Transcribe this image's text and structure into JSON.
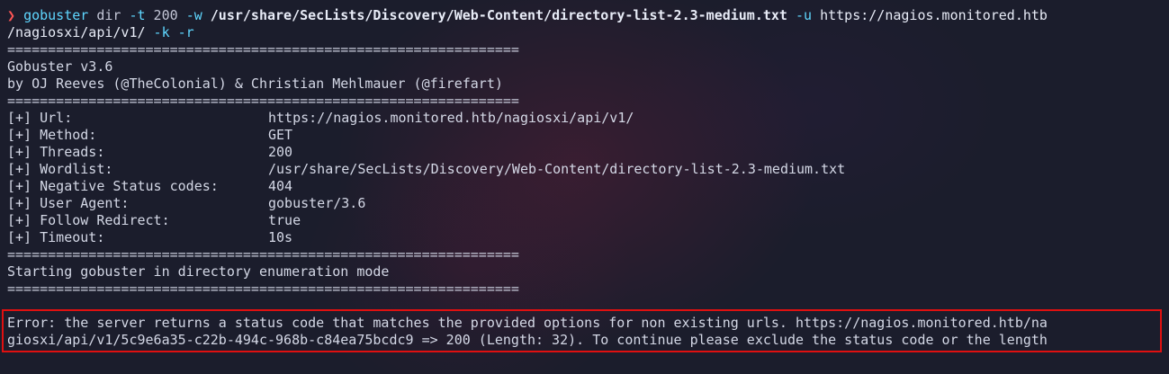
{
  "command": {
    "prompt_symbol": "❯",
    "program": "gobuster",
    "args1": " dir ",
    "flag_t": "-t",
    "threads": " 200 ",
    "flag_w": "-w",
    "wordlist_path": " /usr/share/SecLists/Discovery/Web-Content/directory-list-2.3-medium.txt",
    "flag_u": " -u",
    "url_part1": " https://nagios.monitored.htb",
    "url_part2": "/nagiosxi/api/v1/",
    "flag_k": " -k",
    "flag_r": " -r"
  },
  "separator": "===============================================================",
  "banner": {
    "title": "Gobuster v3.6",
    "authors": "by OJ Reeves (@TheColonial) & Christian Mehlmauer (@firefart)"
  },
  "config": [
    {
      "key": "[+] Url:",
      "value": "https://nagios.monitored.htb/nagiosxi/api/v1/"
    },
    {
      "key": "[+] Method:",
      "value": "GET"
    },
    {
      "key": "[+] Threads:",
      "value": "200"
    },
    {
      "key": "[+] Wordlist:",
      "value": "/usr/share/SecLists/Discovery/Web-Content/directory-list-2.3-medium.txt"
    },
    {
      "key": "[+] Negative Status codes:",
      "value": "404"
    },
    {
      "key": "[+] User Agent:",
      "value": "gobuster/3.6"
    },
    {
      "key": "[+] Follow Redirect:",
      "value": "true"
    },
    {
      "key": "[+] Timeout:",
      "value": "10s"
    }
  ],
  "status": "Starting gobuster in directory enumeration mode",
  "error": {
    "line1": "Error: the server returns a status code that matches the provided options for non existing urls. https://nagios.monitored.htb/na",
    "line2": "giosxi/api/v1/5c9e6a35-c22b-494c-968b-c84ea75bcdc9 => 200 (Length: 32). To continue please exclude the status code or the length"
  },
  "colors": {
    "background": "#1b1d2c",
    "prompt": "#ff5555",
    "command": "#5fd7ff",
    "highlight_box": "#e01010"
  }
}
